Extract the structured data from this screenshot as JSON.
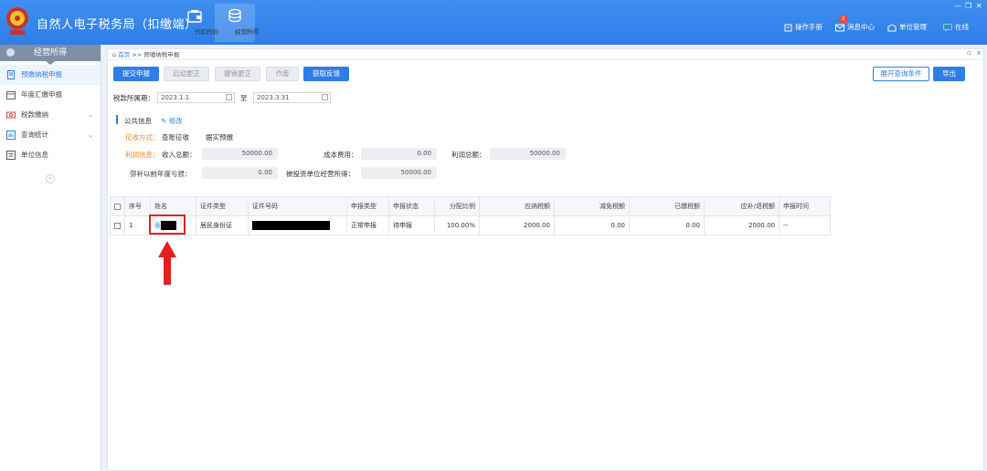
{
  "app": {
    "title": "自然人电子税务局（扣缴端）",
    "brand_color": "#2e7ee8"
  },
  "nav_tabs": [
    {
      "label": "代扣代缴",
      "active": false
    },
    {
      "label": "经营所得",
      "active": true
    }
  ],
  "top_right": {
    "manual": "操作手册",
    "messages": "消息中心",
    "messages_badge": "2",
    "unit_mgmt": "单位管理",
    "online": "在线"
  },
  "sidebar": {
    "header": "经营所得",
    "items": [
      {
        "label": "预缴纳税申报",
        "active": true,
        "has_children": false
      },
      {
        "label": "年度汇缴申报",
        "active": false,
        "has_children": false
      },
      {
        "label": "税款缴纳",
        "active": false,
        "has_children": true
      },
      {
        "label": "查询统计",
        "active": false,
        "has_children": true
      },
      {
        "label": "单位信息",
        "active": false,
        "has_children": false
      }
    ],
    "collapse": "«"
  },
  "breadcrumb": {
    "home": "首页",
    "sep": ">>",
    "current": "预缴纳税申报"
  },
  "toolbar": {
    "submit": "提交申报",
    "start_correction": "启动更正",
    "cancel_correction": "撤销更正",
    "void": "作废",
    "get_feedback": "获取反馈",
    "expand_query": "展开查询条件",
    "export": "导出"
  },
  "period": {
    "label": "税款所属期：",
    "start": "2023.1.1",
    "to": "至",
    "end": "2023.3.31"
  },
  "public_info": {
    "title": "公共信息",
    "edit": "修改",
    "method_label": "征收方式：",
    "method_value": "查账征收",
    "method_detail": "据实预缴",
    "profit_info_label": "利润信息：",
    "revenue_label": "收入总额：",
    "revenue": "50000.00",
    "cost_label": "成本费用：",
    "cost": "0.00",
    "profit_label": "利润总额：",
    "profit": "50000.00",
    "loss_label": "弥补以前年度亏损：",
    "loss": "0.00",
    "investee_label": "被投资单位经营所得：",
    "investee": "50000.00"
  },
  "table": {
    "headers": [
      "序号",
      "姓名",
      "证件类型",
      "证件号码",
      "申报类型",
      "申报状态",
      "分配比例",
      "应纳税额",
      "减免税额",
      "已缴税额",
      "应补/退税额",
      "申报时间"
    ],
    "rows": [
      {
        "index": "1",
        "name_visible": "张",
        "id_type": "居民身份证",
        "decl_type": "正常申报",
        "status": "待申报",
        "ratio": "100.00%",
        "tax_payable": "2000.00",
        "tax_reduced": "0.00",
        "tax_paid": "0.00",
        "tax_due": "2000.00",
        "decl_time": "--"
      }
    ]
  },
  "annotation_color": "#e3211c"
}
